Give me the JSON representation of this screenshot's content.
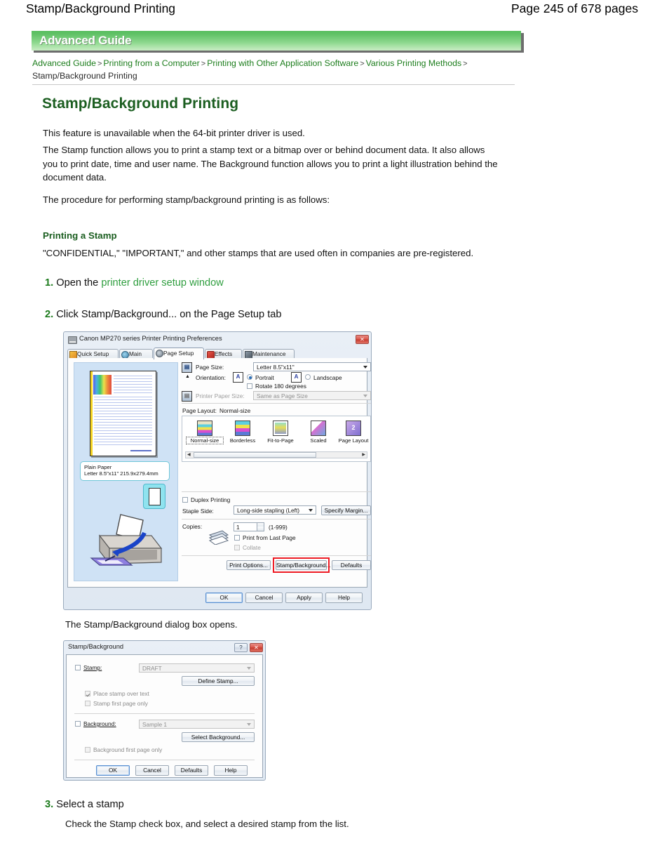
{
  "page_header": {
    "title": "Stamp/Background Printing",
    "page_indicator": "Page 245 of 678 pages"
  },
  "banner": {
    "label": "Advanced Guide"
  },
  "breadcrumb": {
    "items": [
      "Advanced Guide",
      "Printing from a Computer",
      "Printing with Other Application Software",
      "Various Printing Methods"
    ],
    "separator": ">",
    "current": "Stamp/Background Printing"
  },
  "article": {
    "title": "Stamp/Background Printing",
    "intro_1": "This feature is unavailable when the 64-bit printer driver is used.",
    "intro_2": "The Stamp function allows you to print a stamp text or a bitmap over or behind document data. It also allows you to print date, time and user name. The Background function allows you to print a light illustration behind the document data.",
    "intro_3": "The procedure for performing stamp/background printing is as follows:",
    "section_heading": "Printing a Stamp",
    "section_text": "\"CONFIDENTIAL,\" \"IMPORTANT,\" and other stamps that are used often in companies are pre-registered.",
    "steps": [
      {
        "num": "1.",
        "text_before": "Open the ",
        "link": "printer driver setup window",
        "text_after": ""
      },
      {
        "num": "2.",
        "text_before": "Click Stamp/Background... on the Page Setup tab",
        "link": "",
        "text_after": ""
      },
      {
        "num": "3.",
        "text_before": "Select a stamp",
        "link": "",
        "text_after": ""
      }
    ],
    "step3_detail": "Check the Stamp check box, and select a desired stamp from the list.",
    "caption_after_figure1": "The Stamp/Background dialog box opens."
  },
  "prefs_dialog": {
    "title": "Canon MP270 series Printer Printing Preferences",
    "close_label": "✕",
    "tabs": [
      {
        "label": "Quick Setup",
        "active": false
      },
      {
        "label": "Main",
        "active": false
      },
      {
        "label": "Page Setup",
        "active": true
      },
      {
        "label": "Effects",
        "active": false
      },
      {
        "label": "Maintenance",
        "active": false
      }
    ],
    "preview": {
      "media_line1": "Plain Paper",
      "media_line2": "Letter 8.5\"x11\" 215.9x279.4mm"
    },
    "page_size_label": "Page Size:",
    "page_size_value": "Letter 8.5\"x11\"",
    "orientation_label": "Orientation:",
    "portrait_label": "Portrait",
    "landscape_label": "Landscape",
    "portrait_icon_glyph": "A",
    "landscape_icon_glyph": "A",
    "rotate_label": "Rotate 180 degrees",
    "printer_paper_size_label": "Printer Paper Size:",
    "printer_paper_size_value": "Same as Page Size",
    "page_layout_label": "Page Layout:",
    "page_layout_value": "Normal-size",
    "layout_options": [
      "Normal-size",
      "Borderless",
      "Fit-to-Page",
      "Scaled",
      "Page Layout"
    ],
    "layout_selected": "Normal-size",
    "duplex_label": "Duplex Printing",
    "staple_label": "Staple Side:",
    "staple_value": "Long-side stapling (Left)",
    "specify_margin_label": "Specify Margin...",
    "copies_label": "Copies:",
    "copies_value": "1",
    "copies_range": "(1-999)",
    "print_last_label": "Print from Last Page",
    "collate_label": "Collate",
    "print_options_label": "Print Options...",
    "stamp_background_label": "Stamp/Background...",
    "defaults_label": "Defaults",
    "ok_label": "OK",
    "cancel_label": "Cancel",
    "apply_label": "Apply",
    "help_label": "Help",
    "highlight_color": "#ee1c25"
  },
  "stamp_dialog": {
    "title": "Stamp/Background",
    "help_label": "?",
    "close_label": "✕",
    "stamp_label": "Stamp:",
    "stamp_value": "DRAFT",
    "define_stamp_label": "Define Stamp...",
    "place_over_text_label": "Place stamp over text",
    "stamp_first_page_label": "Stamp first page only",
    "background_label": "Background:",
    "background_value": "Sample 1",
    "select_background_label": "Select Background...",
    "background_first_page_label": "Background first page only",
    "ok_label": "OK",
    "cancel_label": "Cancel",
    "defaults_label": "Defaults",
    "help_button_label": "Help"
  }
}
